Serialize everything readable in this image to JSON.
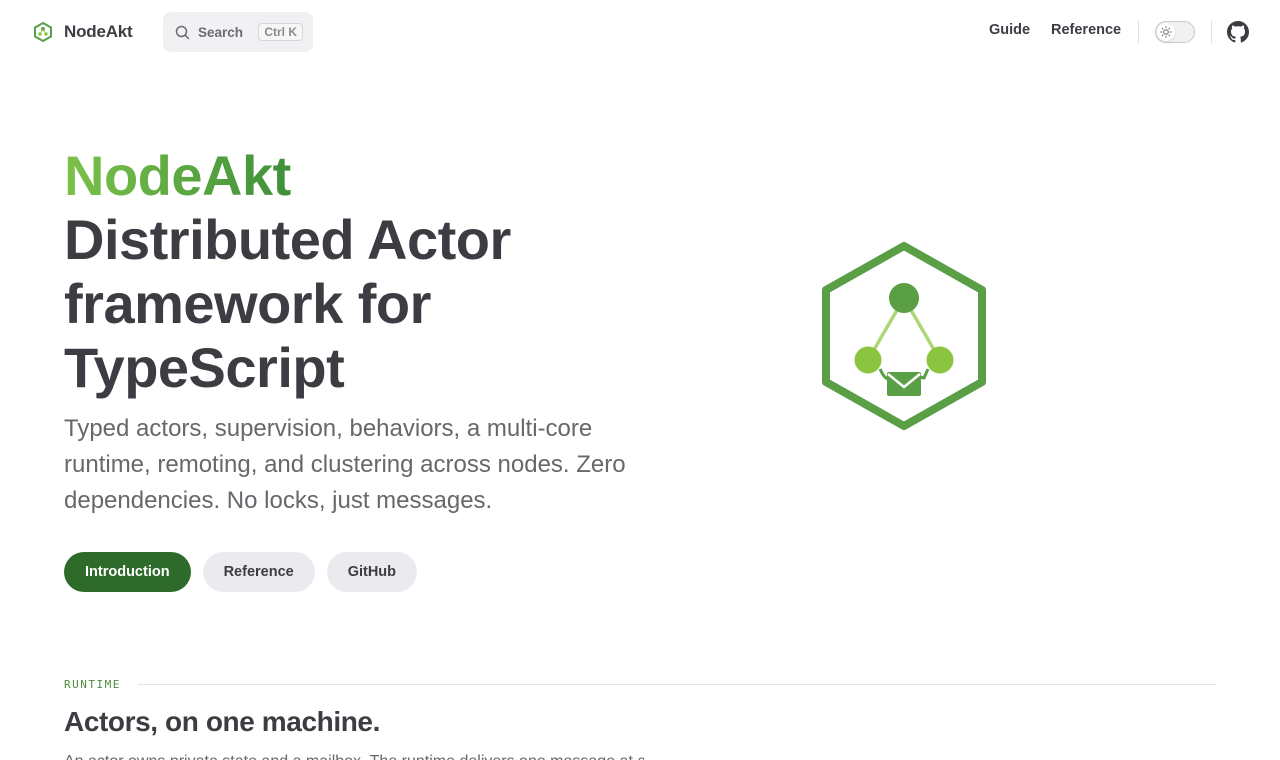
{
  "nav": {
    "brand": "NodeAkt",
    "search": {
      "label": "Search",
      "shortcut_mod": "Ctrl",
      "shortcut_key": "K"
    },
    "links": [
      {
        "label": "Guide"
      },
      {
        "label": "Reference"
      }
    ]
  },
  "hero": {
    "name": "NodeAkt",
    "text": "Distributed Actor framework for TypeScript",
    "tagline": "Typed actors, supervision, behaviors, a multi-core runtime, remoting, and clustering across nodes. Zero dependencies. No locks, just messages.",
    "actions": [
      {
        "label": "Introduction",
        "style": "primary"
      },
      {
        "label": "Reference",
        "style": "alt"
      },
      {
        "label": "GitHub",
        "style": "alt"
      }
    ]
  },
  "section": {
    "label": "RUNTIME",
    "title": "Actors, on one machine.",
    "description": "An actor owns private state and a mailbox. The runtime delivers one message at a"
  },
  "icons": {
    "brand": "hexagon-logo-icon",
    "search": "search-icon",
    "theme": "sun-icon",
    "github": "github-icon",
    "hero": "actor-network-hexagon-icon"
  },
  "colors": {
    "brand_dark": "#2e6b2b",
    "brand_mid": "#5a9e46",
    "brand_light": "#8bc540",
    "text": "#3c3c43",
    "muted": "#67676c"
  }
}
